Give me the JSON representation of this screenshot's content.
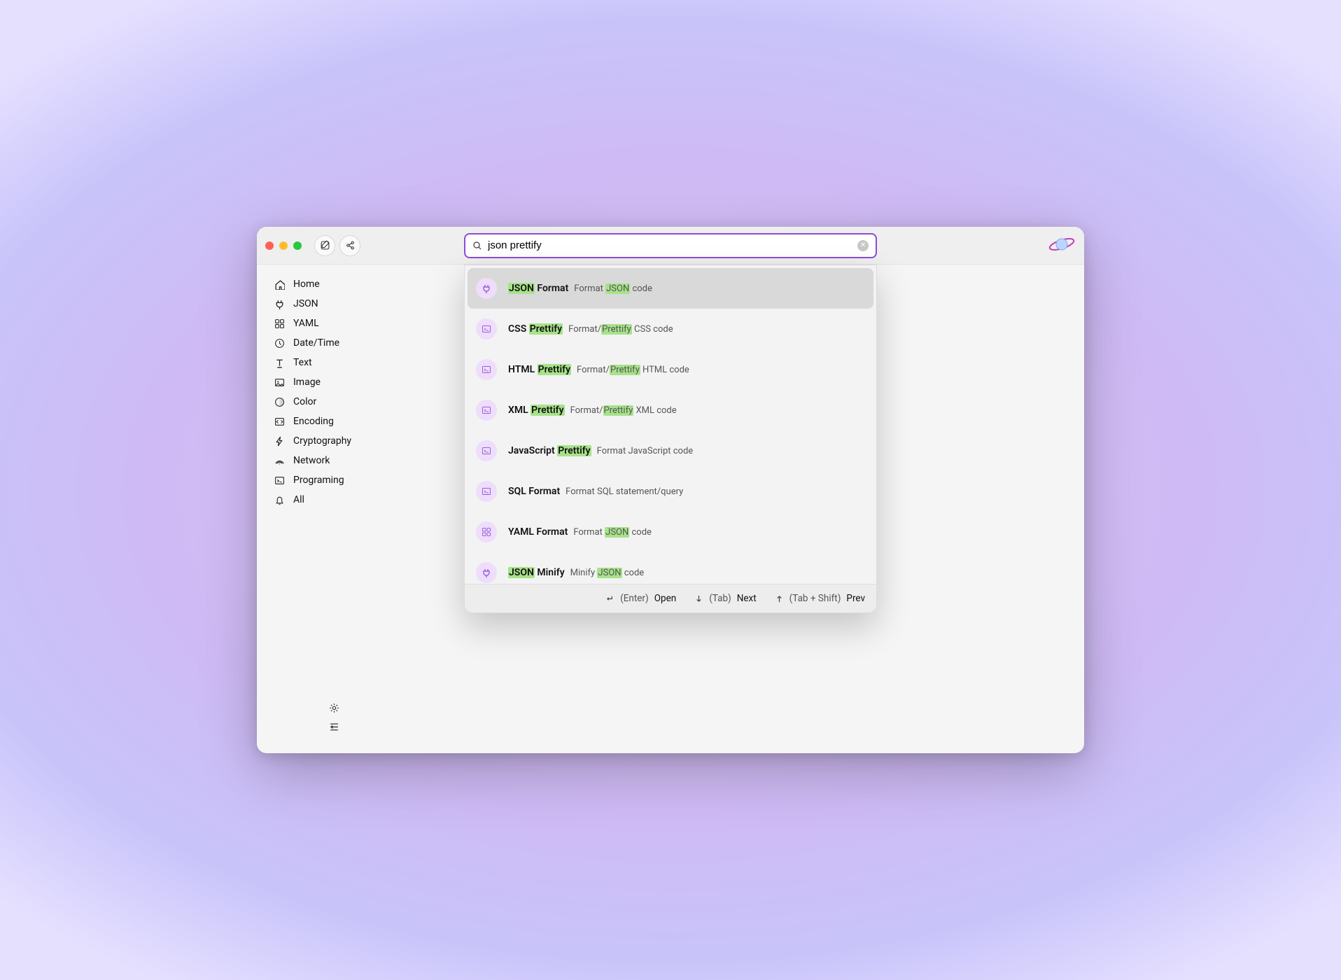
{
  "highlight_color": "#a7e28a",
  "accent_color": "#8a4dd6",
  "search": {
    "value": "json prettify",
    "placeholder": ""
  },
  "sidebar": {
    "items": [
      {
        "icon": "home",
        "label": "Home"
      },
      {
        "icon": "plug",
        "label": "JSON"
      },
      {
        "icon": "grid",
        "label": "YAML"
      },
      {
        "icon": "clock",
        "label": "Date/Time"
      },
      {
        "icon": "text",
        "label": "Text"
      },
      {
        "icon": "image",
        "label": "Image"
      },
      {
        "icon": "color",
        "label": "Color"
      },
      {
        "icon": "encoding",
        "label": "Encoding"
      },
      {
        "icon": "bolt",
        "label": "Cryptography"
      },
      {
        "icon": "network",
        "label": "Network"
      },
      {
        "icon": "terminal",
        "label": "Programing"
      },
      {
        "icon": "bell",
        "label": "All"
      }
    ]
  },
  "results": [
    {
      "icon": "plug",
      "selected": true,
      "title_parts": [
        {
          "t": "JSON",
          "hl": true
        },
        {
          "t": " Format"
        }
      ],
      "sub_parts": [
        {
          "t": "Format "
        },
        {
          "t": "JSON",
          "hl": true
        },
        {
          "t": " code"
        }
      ]
    },
    {
      "icon": "terminal",
      "selected": false,
      "title_parts": [
        {
          "t": "CSS "
        },
        {
          "t": "Prettify",
          "hl": true
        }
      ],
      "sub_parts": [
        {
          "t": "Format/"
        },
        {
          "t": "Prettify",
          "hl": true
        },
        {
          "t": " CSS code"
        }
      ]
    },
    {
      "icon": "terminal",
      "selected": false,
      "title_parts": [
        {
          "t": "HTML "
        },
        {
          "t": "Prettify",
          "hl": true
        }
      ],
      "sub_parts": [
        {
          "t": "Format/"
        },
        {
          "t": "Prettify",
          "hl": true
        },
        {
          "t": " HTML code"
        }
      ]
    },
    {
      "icon": "terminal",
      "selected": false,
      "title_parts": [
        {
          "t": "XML "
        },
        {
          "t": "Prettify",
          "hl": true
        }
      ],
      "sub_parts": [
        {
          "t": "Format/"
        },
        {
          "t": "Prettify",
          "hl": true
        },
        {
          "t": " XML code"
        }
      ]
    },
    {
      "icon": "terminal",
      "selected": false,
      "title_parts": [
        {
          "t": "JavaScript "
        },
        {
          "t": "Prettify",
          "hl": true
        }
      ],
      "sub_parts": [
        {
          "t": "Format JavaScript code"
        }
      ]
    },
    {
      "icon": "terminal",
      "selected": false,
      "title_parts": [
        {
          "t": "SQL Format"
        }
      ],
      "sub_parts": [
        {
          "t": "Format SQL statement/query"
        }
      ]
    },
    {
      "icon": "grid",
      "selected": false,
      "title_parts": [
        {
          "t": "YAML Format"
        }
      ],
      "sub_parts": [
        {
          "t": "Format "
        },
        {
          "t": "JSON",
          "hl": true
        },
        {
          "t": " code"
        }
      ]
    },
    {
      "icon": "plug",
      "selected": false,
      "title_parts": [
        {
          "t": "JSON",
          "hl": true
        },
        {
          "t": " Minify"
        }
      ],
      "sub_parts": [
        {
          "t": "Minify "
        },
        {
          "t": "JSON",
          "hl": true
        },
        {
          "t": " code"
        }
      ]
    }
  ],
  "footer": {
    "hints": [
      {
        "icon": "enter",
        "key": "(Enter)",
        "label": "Open"
      },
      {
        "icon": "down",
        "key": "(Tab)",
        "label": "Next"
      },
      {
        "icon": "up",
        "key": "(Tab + Shift)",
        "label": "Prev"
      }
    ]
  }
}
